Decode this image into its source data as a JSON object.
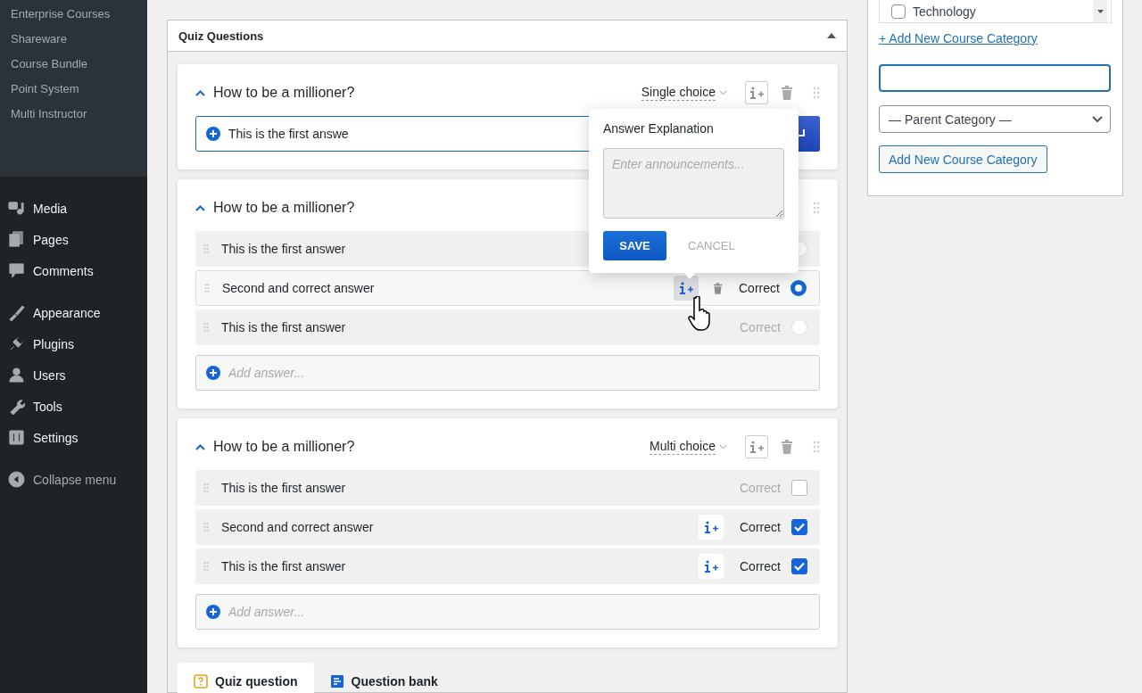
{
  "sidebar": {
    "submenu": [
      "Enterprise Courses",
      "Shareware",
      "Course Bundle",
      "Point System",
      "Multi Instructor"
    ],
    "menu_groups": [
      [
        "Media",
        "Pages",
        "Comments"
      ],
      [
        "Appearance",
        "Plugins",
        "Users",
        "Tools",
        "Settings"
      ]
    ],
    "collapse": "Collapse menu"
  },
  "quiz_panel": {
    "title": "Quiz Questions",
    "expanded": true,
    "questions": [
      {
        "title": "How to be a millioner?",
        "expanded": true,
        "type": "Single choice",
        "editing": true,
        "answer_input": "This is the first answe"
      },
      {
        "title": "How to be a millioner?",
        "expanded": true,
        "kind": "radio",
        "answers": [
          {
            "text": "This is the first answer",
            "correct": false,
            "hovered": false
          },
          {
            "text": "Second and correct answer",
            "correct": true,
            "hovered": true,
            "correct_label": "Correct"
          },
          {
            "text": "This is the first answer",
            "correct": false,
            "hovered": false,
            "correct_label": "Correct"
          }
        ],
        "add_placeholder": "Add answer..."
      },
      {
        "title": "How to be a millioner?",
        "expanded": true,
        "type": "Multi choice",
        "kind": "checkbox",
        "answers": [
          {
            "text": "This is the first answer",
            "correct": false,
            "hovered": false,
            "correct_label": "Correct"
          },
          {
            "text": "Second and correct answer",
            "correct": true,
            "hovered": false,
            "correct_label": "Correct"
          },
          {
            "text": "This is the first answer",
            "correct": true,
            "hovered": false,
            "correct_label": "Correct"
          }
        ],
        "add_placeholder": "Add answer..."
      }
    ],
    "tabs": [
      {
        "label": "Quiz question",
        "selected": true
      },
      {
        "label": "Question bank",
        "selected": false
      }
    ]
  },
  "explanation_popup": {
    "title": "Answer Explanation",
    "placeholder": "Enter announcements...",
    "save": "SAVE",
    "cancel": "CANCEL"
  },
  "category_panel": {
    "categories": [
      {
        "label": "Technology",
        "checked": false
      }
    ],
    "add_link": "+ Add New Course Category",
    "parent_select": "— Parent Category —",
    "add_button": "Add New Course Category"
  }
}
